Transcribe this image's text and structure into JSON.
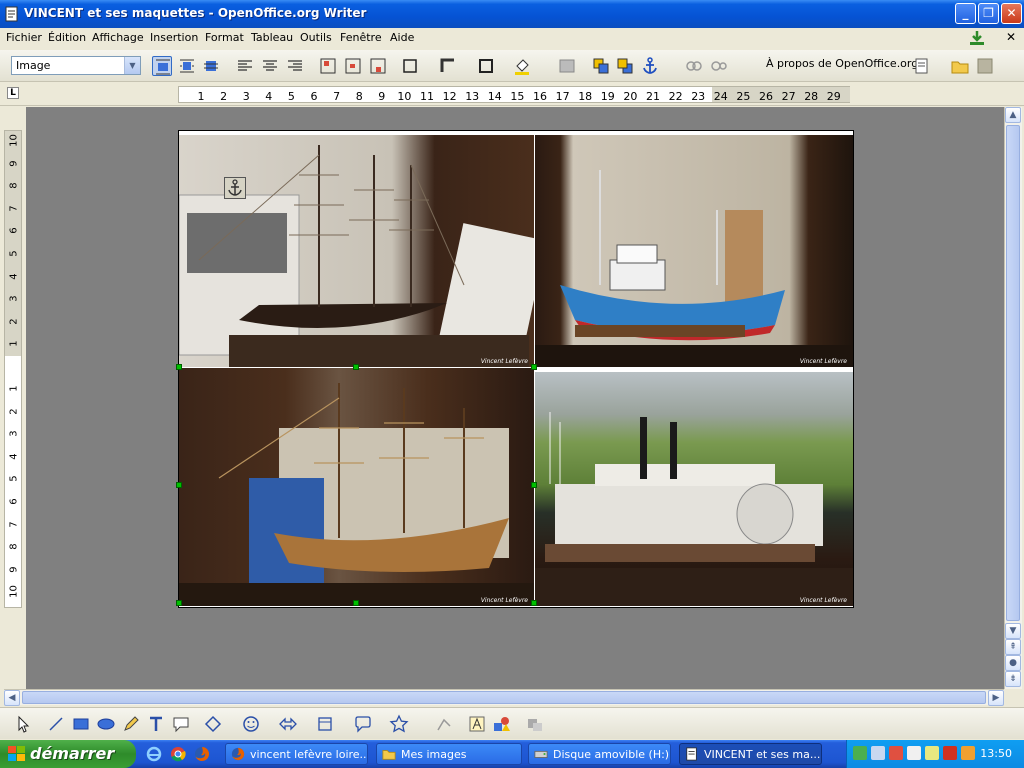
{
  "window": {
    "title": "VINCENT et ses maquettes - OpenOffice.org Writer",
    "buttons": {
      "minimize": "_",
      "maximize": "❐",
      "close": "✕"
    }
  },
  "menubar": {
    "items": [
      "Fichier",
      "Édition",
      "Affichage",
      "Insertion",
      "Format",
      "Tableau",
      "Outils",
      "Fenêtre",
      "Aide"
    ]
  },
  "toolbar": {
    "style_value": "Image",
    "about_label": "À propos de OpenOffice.org"
  },
  "ruler": {
    "horizontal": [
      "1",
      "2",
      "3",
      "4",
      "5",
      "6",
      "7",
      "8",
      "9",
      "10",
      "11",
      "12",
      "13",
      "14",
      "15",
      "16",
      "17",
      "18",
      "19",
      "20",
      "21",
      "22",
      "23",
      "24",
      "25",
      "26",
      "27",
      "28",
      "29"
    ],
    "vertical_top": [
      "10",
      "9",
      "8",
      "7",
      "6",
      "5",
      "4",
      "3",
      "2",
      "1"
    ],
    "vertical_bottom": [
      "1",
      "2",
      "3",
      "4",
      "5",
      "6",
      "7",
      "8",
      "9",
      "10"
    ],
    "corner": "L"
  },
  "document": {
    "photos": [
      {
        "caption": "Vincent Lefèvre",
        "subject": "three-masted ship model"
      },
      {
        "caption": "Vincent Lefèvre",
        "subject": "blue fishing boat model"
      },
      {
        "caption": "Vincent Lefèvre",
        "subject": "wooden galleon model"
      },
      {
        "caption": "Vincent Lefèvre",
        "subject": "paddle steamer model"
      }
    ]
  },
  "taskbar": {
    "start_label": "démarrer",
    "tasks": [
      {
        "label": "vincent lefèvre loire...",
        "active": false
      },
      {
        "label": "Mes images",
        "active": false
      },
      {
        "label": "Disque amovible (H:)",
        "active": false
      },
      {
        "label": "VINCENT et ses ma...",
        "active": true
      }
    ],
    "clock": "13:50"
  },
  "colors": {
    "titlebar": "#0653d4",
    "workspace": "#808080",
    "selection_handle": "#00c000",
    "taskbar": "#245edb",
    "start": "#3a9e33"
  }
}
